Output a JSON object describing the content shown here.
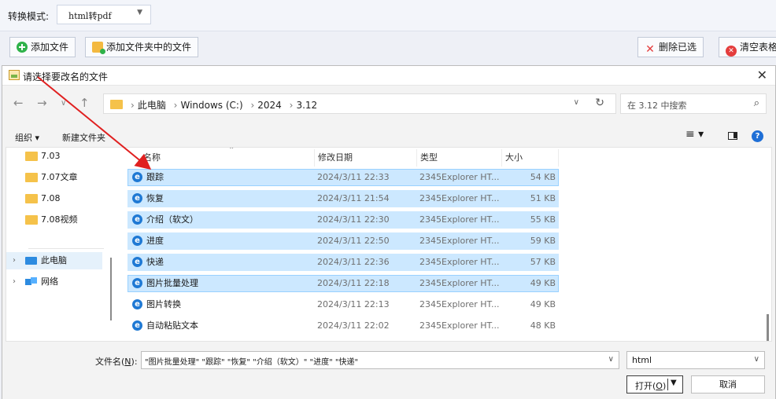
{
  "app": {
    "mode_label": "转换模式:",
    "mode_value": "html转pdf",
    "buttons": {
      "add_file": "添加文件",
      "add_folder_files": "添加文件夹中的文件",
      "delete_selected": "删除已选",
      "clear_table": "清空表格"
    }
  },
  "dialog": {
    "title": "请选择要改名的文件",
    "address": {
      "crumbs": [
        "此电脑",
        "Windows (C:)",
        "2024",
        "3.12"
      ]
    },
    "search_placeholder": "在 3.12 中搜索",
    "cmdbar": {
      "organize": "组织 ▾",
      "new_folder": "新建文件夹"
    },
    "tree": [
      {
        "label": "7.03",
        "kind": "folder"
      },
      {
        "label": "7.07文章",
        "kind": "folder"
      },
      {
        "label": "7.08",
        "kind": "folder"
      },
      {
        "label": "7.08视频",
        "kind": "folder"
      },
      {
        "label": "此电脑",
        "kind": "pc",
        "selected": true
      },
      {
        "label": "网络",
        "kind": "network"
      }
    ],
    "columns": {
      "name": "名称",
      "modified": "修改日期",
      "type": "类型",
      "size": "大小"
    },
    "files": [
      {
        "name": "跟踪",
        "modified": "2024/3/11 22:33",
        "type": "2345Explorer HT...",
        "size": "54 KB",
        "selected": true
      },
      {
        "name": "恢复",
        "modified": "2024/3/11 21:54",
        "type": "2345Explorer HT...",
        "size": "51 KB",
        "selected": true
      },
      {
        "name": "介绍（软文）",
        "modified": "2024/3/11 22:30",
        "type": "2345Explorer HT...",
        "size": "55 KB",
        "selected": true
      },
      {
        "name": "进度",
        "modified": "2024/3/11 22:50",
        "type": "2345Explorer HT...",
        "size": "59 KB",
        "selected": true
      },
      {
        "name": "快递",
        "modified": "2024/3/11 22:36",
        "type": "2345Explorer HT...",
        "size": "57 KB",
        "selected": true
      },
      {
        "name": "图片批量处理",
        "modified": "2024/3/11 22:18",
        "type": "2345Explorer HT...",
        "size": "49 KB",
        "selected": true
      },
      {
        "name": "图片转换",
        "modified": "2024/3/11 22:13",
        "type": "2345Explorer HT...",
        "size": "49 KB",
        "selected": false
      },
      {
        "name": "自动粘贴文本",
        "modified": "2024/3/11 22:02",
        "type": "2345Explorer HT...",
        "size": "48 KB",
        "selected": false
      }
    ],
    "filename_label": "文件名",
    "filename_mnemonic": "N",
    "filename_value": "\"图片批量处理\" \"跟踪\" \"恢复\" \"介绍（软文）\" \"进度\" \"快递\"",
    "filetype_value": "html",
    "open_label": "打开",
    "open_mnemonic": "O",
    "cancel_label": "取消"
  },
  "colors": {
    "selection": "#cce8ff",
    "accent": "#1f79d4",
    "arrow": "#e02020"
  }
}
